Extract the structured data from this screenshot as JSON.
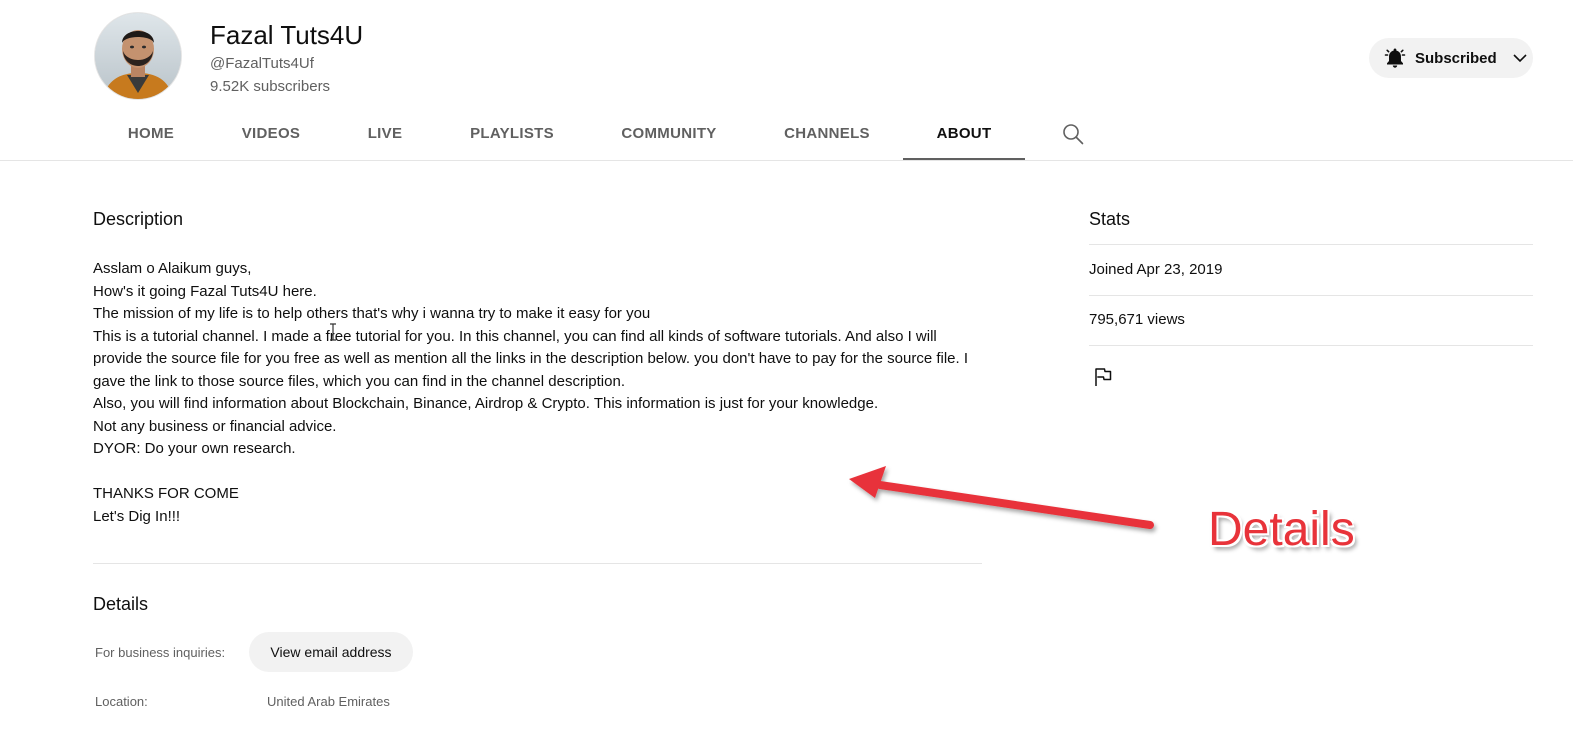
{
  "channel": {
    "name": "Fazal Tuts4U",
    "handle": "@FazalTuts4Uf",
    "subscribers": "9.52K subscribers",
    "subscribe_button": {
      "label": "Subscribed",
      "icon": "bell-icon"
    }
  },
  "tabs": [
    {
      "label": "HOME",
      "active": false
    },
    {
      "label": "VIDEOS",
      "active": false
    },
    {
      "label": "LIVE",
      "active": false
    },
    {
      "label": "PLAYLISTS",
      "active": false
    },
    {
      "label": "COMMUNITY",
      "active": false
    },
    {
      "label": "CHANNELS",
      "active": false
    },
    {
      "label": "ABOUT",
      "active": true
    }
  ],
  "description": {
    "heading": "Description",
    "lines": [
      "Asslam o Alaikum guys,",
      "How's it going Fazal Tuts4U here.",
      "The mission of my life is to help others that's why i wanna try to make it easy for you",
      "This is a tutorial channel. I made a free tutorial for you. In this channel, you can find all kinds of software tutorials. And also I will provide the source file for you free as well as mention all the links in the description below. you don't have to pay for the source file. I gave the link to those source files, which you can find in the channel description.",
      "Also, you will find information about Blockchain, Binance, Airdrop & Crypto. This information is just for your knowledge.",
      "Not any business or financial advice.",
      "DYOR: Do your own research.",
      "",
      "THANKS FOR COME",
      "Let's Dig In!!!"
    ]
  },
  "details": {
    "heading": "Details",
    "business_label": "For business inquiries:",
    "email_button": "View email address",
    "location_label": "Location:",
    "location_value": "United Arab Emirates"
  },
  "stats": {
    "heading": "Stats",
    "joined": "Joined Apr 23, 2019",
    "views": "795,671 views"
  },
  "annotation": {
    "label": "Details",
    "color": "#e8333a"
  },
  "colors": {
    "text_primary": "#0f0f0f",
    "text_secondary": "#606060",
    "button_bg": "#f2f2f2",
    "divider": "#e5e5e5"
  }
}
